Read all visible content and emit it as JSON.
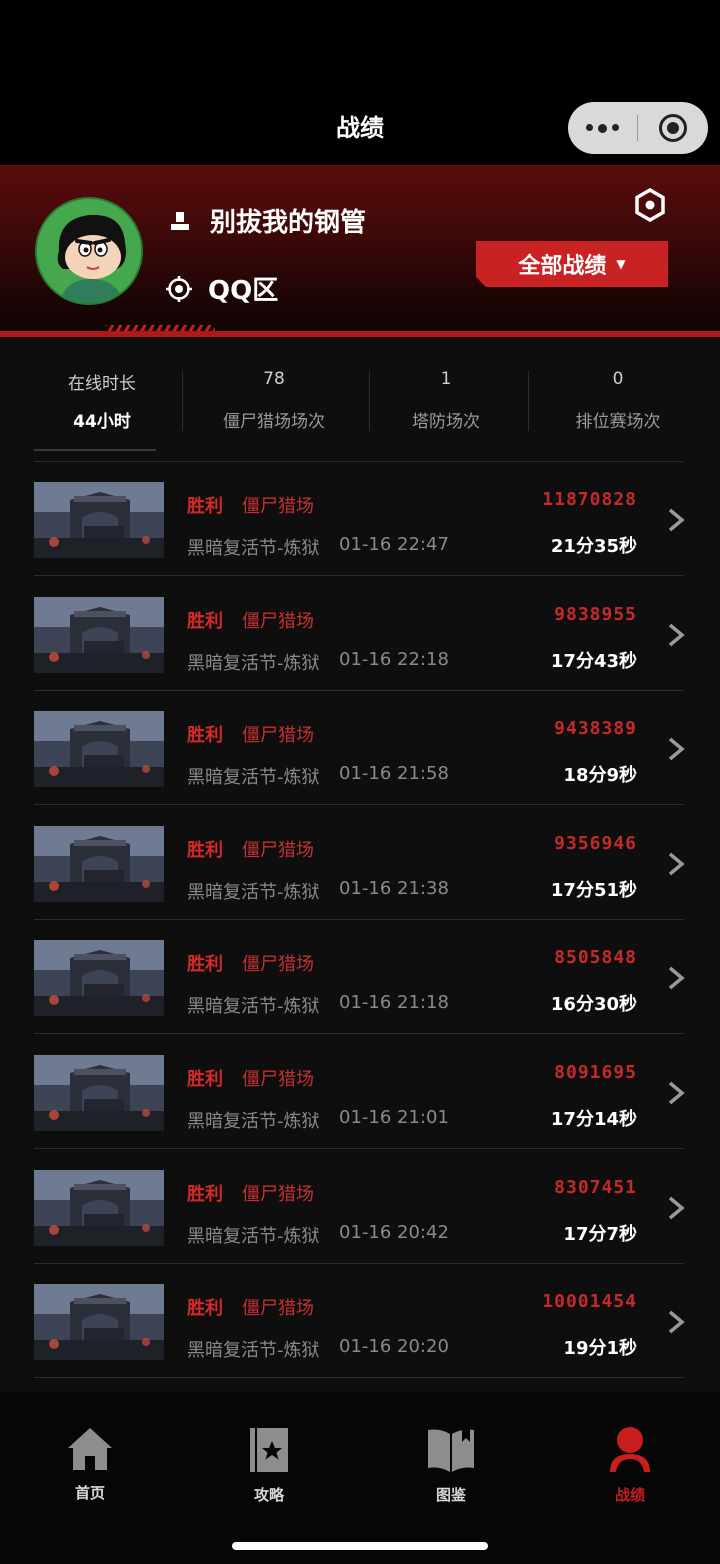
{
  "nav": {
    "title": "战绩"
  },
  "profile": {
    "username": "别拔我的钢管",
    "region": "QQ区",
    "filter_label": "全部战绩"
  },
  "stats": [
    {
      "top": "在线时长",
      "bottom": "44小时"
    },
    {
      "top": "78",
      "bottom": "僵尸猎场场次"
    },
    {
      "top": "1",
      "bottom": "塔防场次"
    },
    {
      "top": "0",
      "bottom": "排位赛场次"
    }
  ],
  "records": [
    {
      "result": "胜利",
      "mode": "僵尸猎场",
      "map": "黑暗复活节-炼狱",
      "time": "01-16 22:47",
      "score": "11870828",
      "duration": "21分35秒"
    },
    {
      "result": "胜利",
      "mode": "僵尸猎场",
      "map": "黑暗复活节-炼狱",
      "time": "01-16 22:18",
      "score": "9838955",
      "duration": "17分43秒"
    },
    {
      "result": "胜利",
      "mode": "僵尸猎场",
      "map": "黑暗复活节-炼狱",
      "time": "01-16 21:58",
      "score": "9438389",
      "duration": "18分9秒"
    },
    {
      "result": "胜利",
      "mode": "僵尸猎场",
      "map": "黑暗复活节-炼狱",
      "time": "01-16 21:38",
      "score": "9356946",
      "duration": "17分51秒"
    },
    {
      "result": "胜利",
      "mode": "僵尸猎场",
      "map": "黑暗复活节-炼狱",
      "time": "01-16 21:18",
      "score": "8505848",
      "duration": "16分30秒"
    },
    {
      "result": "胜利",
      "mode": "僵尸猎场",
      "map": "黑暗复活节-炼狱",
      "time": "01-16 21:01",
      "score": "8091695",
      "duration": "17分14秒"
    },
    {
      "result": "胜利",
      "mode": "僵尸猎场",
      "map": "黑暗复活节-炼狱",
      "time": "01-16 20:42",
      "score": "8307451",
      "duration": "17分7秒"
    },
    {
      "result": "胜利",
      "mode": "僵尸猎场",
      "map": "黑暗复活节-炼狱",
      "time": "01-16 20:20",
      "score": "10001454",
      "duration": "19分1秒"
    }
  ],
  "tabs": [
    {
      "label": "首页",
      "icon": "home-icon"
    },
    {
      "label": "攻略",
      "icon": "guide-book-icon"
    },
    {
      "label": "图鉴",
      "icon": "open-book-icon"
    },
    {
      "label": "战绩",
      "icon": "profile-icon",
      "active": true
    }
  ],
  "colors": {
    "accent": "#c92222",
    "background": "#0e0e0e"
  }
}
